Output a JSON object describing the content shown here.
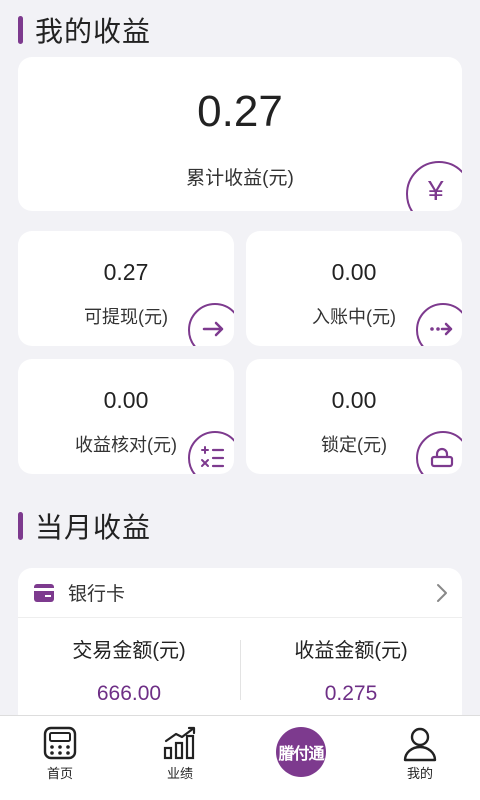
{
  "earnings": {
    "title": "我的收益",
    "total_value": "0.27",
    "total_label": "累计收益(元)",
    "yen_symbol": "¥",
    "cards": [
      {
        "value": "0.27",
        "label": "可提现(元)"
      },
      {
        "value": "0.00",
        "label": "入账中(元)"
      },
      {
        "value": "0.00",
        "label": "收益核对(元)"
      },
      {
        "value": "0.00",
        "label": "锁定(元)"
      }
    ]
  },
  "monthly": {
    "title": "当月收益",
    "bank_name": "银行卡",
    "col1_header": "交易金额(元)",
    "col1_value": "666.00",
    "col2_header": "收益金额(元)",
    "col2_value": "0.275"
  },
  "tabbar": {
    "home": "首页",
    "performance": "业绩",
    "pay": "膡付通",
    "mine": "我的"
  },
  "colors": {
    "accent": "#7d3a8e",
    "value_purple": "#6e2f86",
    "background": "#f2f2f6"
  }
}
